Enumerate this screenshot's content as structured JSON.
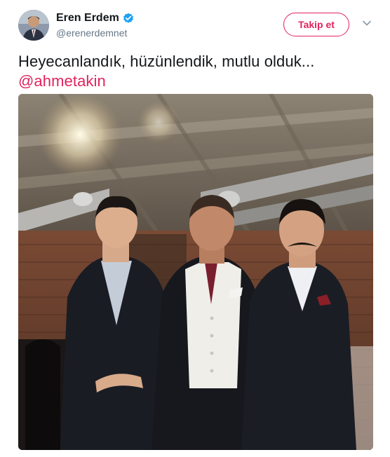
{
  "user": {
    "display_name": "Eren Erdem",
    "handle": "@erenerdemnet",
    "verified": true
  },
  "actions": {
    "follow_label": "Takip et",
    "more_icon": "chevron-down-icon"
  },
  "tweet": {
    "text": "Heyecanlandık, hüzünlendik, mutlu olduk...",
    "mention": "@ahmetakin"
  },
  "colors": {
    "accent": "#e0245e",
    "verified_blue": "#1da1f2",
    "secondary_text": "#657786"
  },
  "photo": {
    "subject": "three men standing in a restaurant"
  }
}
